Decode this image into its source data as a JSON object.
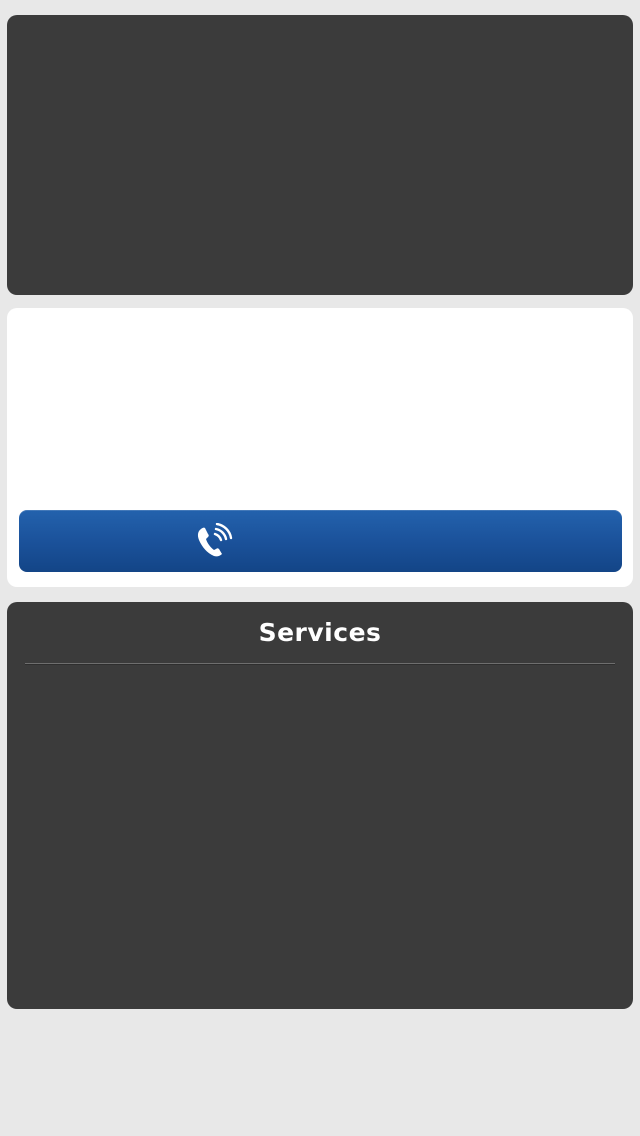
{
  "call_button": {
    "icon": "phone-calling-icon",
    "color": "#1b529b"
  },
  "services": {
    "title": "Services"
  },
  "colors": {
    "background": "#e8e8e8",
    "dark_card": "#3b3b3b",
    "light_card": "#ffffff",
    "accent": "#1b529b"
  }
}
